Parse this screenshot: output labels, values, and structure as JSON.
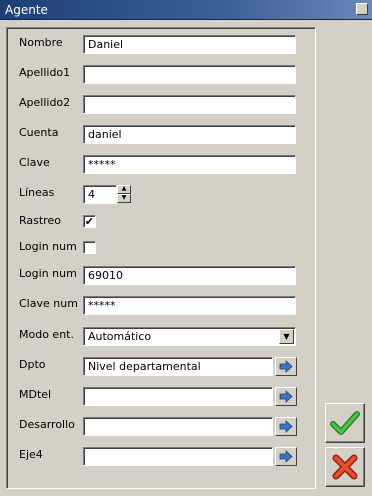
{
  "window": {
    "title": "Agente"
  },
  "form": {
    "nombre": {
      "label": "Nombre",
      "value": "Daniel"
    },
    "apellido1": {
      "label": "Apellido1",
      "value": ""
    },
    "apellido2": {
      "label": "Apellido2",
      "value": ""
    },
    "cuenta": {
      "label": "Cuenta",
      "value": "daniel"
    },
    "clave": {
      "label": "Clave",
      "value": "*****"
    },
    "lineas": {
      "label": "Líneas",
      "value": "4"
    },
    "rastreo": {
      "label": "Rastreo",
      "checked": true,
      "mark": "✔"
    },
    "login_chk": {
      "label": "Login num",
      "checked": false,
      "mark": ""
    },
    "login_num": {
      "label": "Login num",
      "value": "69010"
    },
    "clave_num": {
      "label": "Clave num",
      "value": "*****"
    },
    "modo_ent": {
      "label": "Modo ent.",
      "value": "Automático"
    },
    "dpto": {
      "label": "Dpto",
      "value": "Nivel departamental"
    },
    "mdtel": {
      "label": "MDtel",
      "value": ""
    },
    "desarrollo": {
      "label": "Desarrollo",
      "value": ""
    },
    "eje4": {
      "label": "Eje4",
      "value": ""
    }
  },
  "icons": {
    "go": "arrow-right-icon",
    "ok": "green-check-icon",
    "cancel": "red-x-icon",
    "dropdown": "chevron-down-icon",
    "spin_up": "triangle-up-icon",
    "spin_down": "triangle-down-icon"
  },
  "colors": {
    "title_bar": "#1c3f76",
    "ok": "#2e9e2e",
    "cancel": "#d23a1a",
    "go_arrow": "#3b74c4"
  }
}
